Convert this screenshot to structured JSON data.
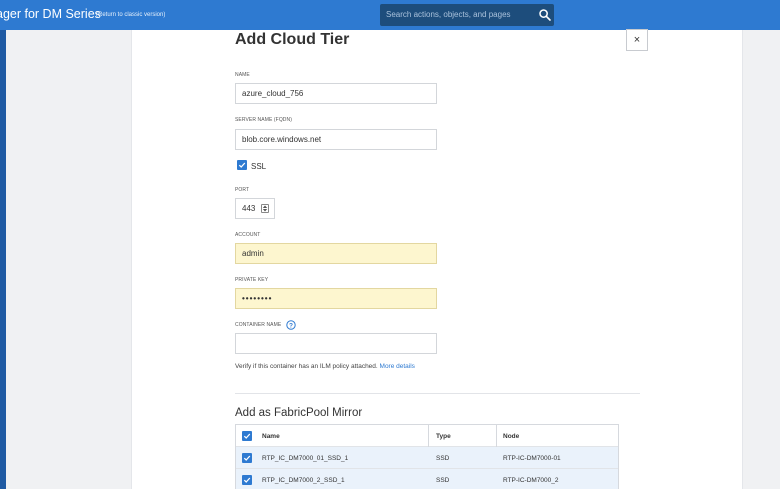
{
  "header": {
    "app_title": "ager for DM Series",
    "classic_link": "(Return to classic version)",
    "search_placeholder": "Search actions, objects, and pages",
    "search_icon": "search-icon"
  },
  "dialog": {
    "title": "Add Cloud Tier",
    "close_label": "×",
    "name": {
      "label": "NAME",
      "value": "azure_cloud_756"
    },
    "server": {
      "label": "SERVER NAME (FQDN)",
      "value": "blob.core.windows.net"
    },
    "ssl": {
      "label": "SSL",
      "checked": true
    },
    "port": {
      "label": "PORT",
      "value": "443"
    },
    "account": {
      "label": "ACCOUNT",
      "value": "admin"
    },
    "private_key": {
      "label": "PRIVATE KEY",
      "value": "••••••••"
    },
    "container": {
      "label": "CONTAINER NAME",
      "value": "",
      "help_icon": "question-circle-icon"
    },
    "verify_text": "Verify if this container has an ILM policy attached.",
    "more_details": "More details"
  },
  "mirror": {
    "title": "Add as FabricPool Mirror",
    "columns": {
      "name": "Name",
      "type": "Type",
      "node": "Node"
    },
    "rows": [
      {
        "name": "RTP_IC_DM7000_01_SSD_1",
        "type": "SSD",
        "node": "RTP-IC-DM7000-01",
        "checked": true
      },
      {
        "name": "RTP_IC_DM7000_2_SSD_1",
        "type": "SSD",
        "node": "RTP-IC-DM7000_2",
        "checked": true
      }
    ]
  },
  "colors": {
    "topbar": "#2e7ad1",
    "search_bg": "#1d4d7c",
    "accent": "#2e7ad1",
    "autofill": "#fdf6cf"
  }
}
